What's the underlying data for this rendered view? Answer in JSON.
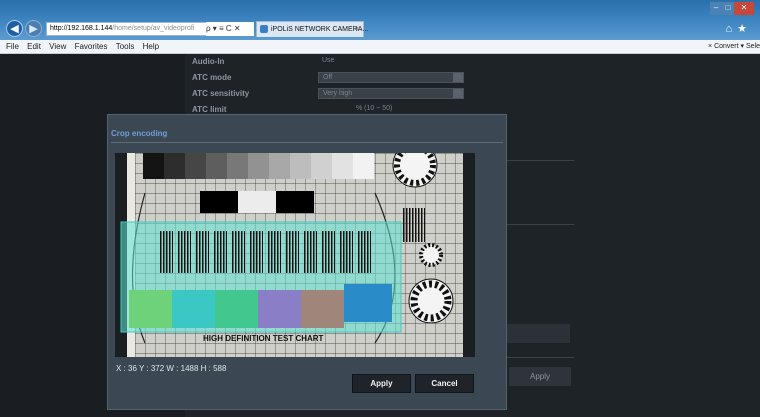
{
  "browser": {
    "url_host": "http://192.168.1.144",
    "url_path": "/home/setup/av_videoprofi",
    "address_controls": "ρ ▾ ≡ C ✕",
    "tab_title": "iPOLiS NETWORK CAMERA...",
    "tab_close": "×",
    "menu": [
      "File",
      "Edit",
      "View",
      "Favorites",
      "Tools",
      "Help"
    ],
    "command_right": "×  Convert  ▾  Sele"
  },
  "settings": {
    "rows": [
      {
        "label": "Audio-In",
        "value": "Use"
      },
      {
        "label": "ATC mode",
        "value": "Off"
      },
      {
        "label": "ATC sensitivity",
        "value": "Very high"
      },
      {
        "label": "ATC limit",
        "value": "% (10 ~ 50)"
      }
    ],
    "apply_label": "Apply"
  },
  "dialog": {
    "title": "Crop encoding",
    "coords": "X : 36 Y : 372 W : 1488 H : 588",
    "apply_label": "Apply",
    "cancel_label": "Cancel",
    "chart_caption": "HIGH DEFINITION TEST CHART"
  },
  "colors": {
    "title_accent": "#6f9fd0",
    "crop_selection": "#5fe3d6",
    "patches": [
      "#6ed27a",
      "#3bc8c4",
      "#42c88e",
      "#8a7fc7",
      "#a0867a",
      "#2a8bc9"
    ]
  }
}
